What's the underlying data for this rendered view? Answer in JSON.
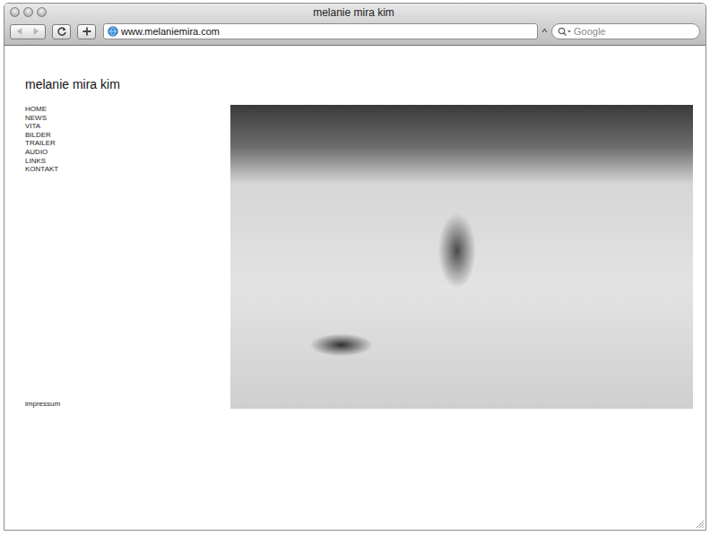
{
  "window": {
    "title": "melanie mira kim"
  },
  "toolbar": {
    "url": "www.melaniemira.com",
    "search_placeholder": "Google"
  },
  "page": {
    "site_title": "melanie mira kim",
    "nav": [
      {
        "label": "HOME"
      },
      {
        "label": "NEWS"
      },
      {
        "label": "VITA"
      },
      {
        "label": "BILDER"
      },
      {
        "label": "TRAILER"
      },
      {
        "label": "AUDIO"
      },
      {
        "label": "LINKS"
      },
      {
        "label": "KONTAKT"
      }
    ],
    "footer_link": "impressum"
  }
}
